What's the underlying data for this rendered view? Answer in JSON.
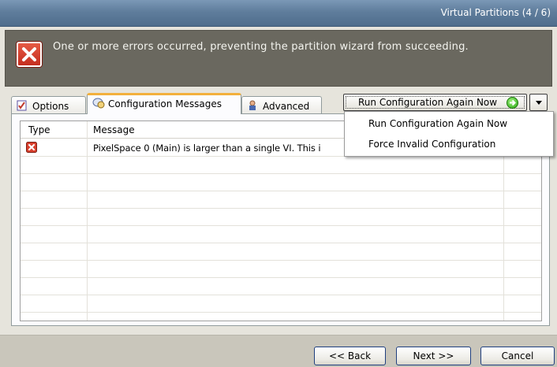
{
  "window": {
    "title": "Virtual Partitions (4 / 6)"
  },
  "header": {
    "icon": "error-x-icon",
    "message": "One or more errors occurred, preventing the partition wizard from succeeding."
  },
  "tabs": [
    {
      "label": "Options",
      "icon": "options-icon",
      "active": false
    },
    {
      "label": "Configuration Messages",
      "icon": "messages-icon",
      "active": true
    },
    {
      "label": "Advanced",
      "icon": "advanced-icon",
      "active": false
    }
  ],
  "run_button": {
    "label": "Run Configuration Again Now",
    "icon": "green-arrow-icon"
  },
  "dropdown_menu": {
    "items": [
      "Run Configuration Again Now",
      "Force Invalid Configuration"
    ]
  },
  "grid": {
    "columns": [
      "Type",
      "Message"
    ],
    "rows": [
      {
        "type_icon": "error-icon",
        "message": "PixelSpace 0 (Main) is larger than a single VI.  This i"
      }
    ]
  },
  "footer": {
    "back_label": "<< Back",
    "next_label": "Next >>",
    "cancel_label": "Cancel"
  },
  "colors": {
    "header_bg": "#6a685f",
    "active_tab_accent": "#f3b03c",
    "error_red": "#d9402e"
  }
}
